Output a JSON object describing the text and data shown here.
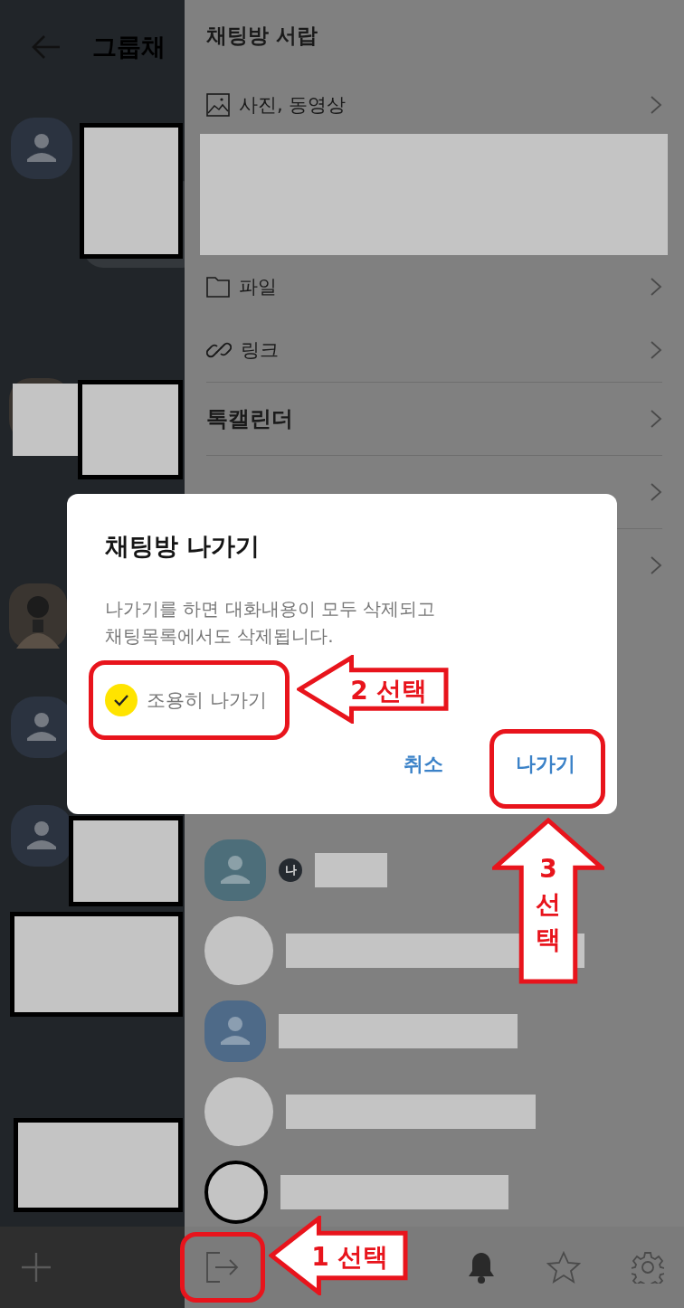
{
  "chat": {
    "title": "그룹채"
  },
  "drawer": {
    "title": "채팅방 서랍",
    "items": [
      {
        "kind": "media",
        "label": "사진, 동영상"
      },
      {
        "kind": "files",
        "label": "파일"
      },
      {
        "kind": "links",
        "label": "링크"
      },
      {
        "kind": "plain",
        "label": "톡캘린더"
      },
      {
        "kind": "covered"
      },
      {
        "kind": "covered"
      }
    ],
    "members": [
      {
        "kind": "default",
        "badge": "나"
      },
      {
        "kind": "redacted"
      },
      {
        "kind": "default"
      },
      {
        "kind": "redacted"
      },
      {
        "kind": "redacted"
      }
    ]
  },
  "dialog": {
    "title": "채팅방 나가기",
    "message": "나가기를 하면 대화내용이 모두 삭제되고\n채팅목록에서도 삭제됩니다.",
    "quiet_exit": {
      "label": "조용히 나가기",
      "checked": true
    },
    "buttons": [
      {
        "label": "취소"
      },
      {
        "label": "나가기"
      }
    ]
  },
  "annotations": [
    {
      "kind": "left",
      "text": "2 선택"
    },
    {
      "kind": "up",
      "text": "3 선택"
    },
    {
      "kind": "left",
      "text": "1 선택"
    }
  ]
}
